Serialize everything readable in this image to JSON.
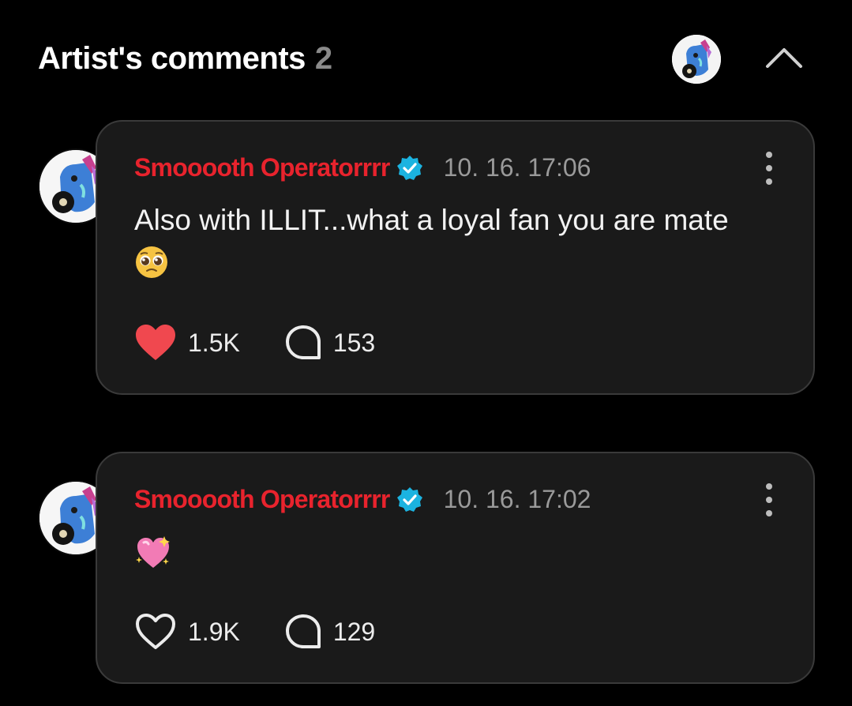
{
  "header": {
    "title": "Artist's comments",
    "count": "2"
  },
  "colors": {
    "background": "#000000",
    "card": "#1a1a1a",
    "author": "#e8232d",
    "verified": "#1bb3e0",
    "liked_heart": "#f0484f",
    "muted": "#9a9a9a"
  },
  "comments": [
    {
      "author": "Smooooth Operatorrrr",
      "verified": true,
      "timestamp": "10. 16. 17:06",
      "text": "Also with ILLIT...what a loyal fan you are mate",
      "emoji": "pleading-face-emoji",
      "liked": true,
      "likes": "1.5K",
      "replies": "153"
    },
    {
      "author": "Smooooth Operatorrrr",
      "verified": true,
      "timestamp": "10. 16. 17:02",
      "text": "",
      "emoji": "sparkling-heart-emoji",
      "liked": false,
      "likes": "1.9K",
      "replies": "129"
    }
  ]
}
